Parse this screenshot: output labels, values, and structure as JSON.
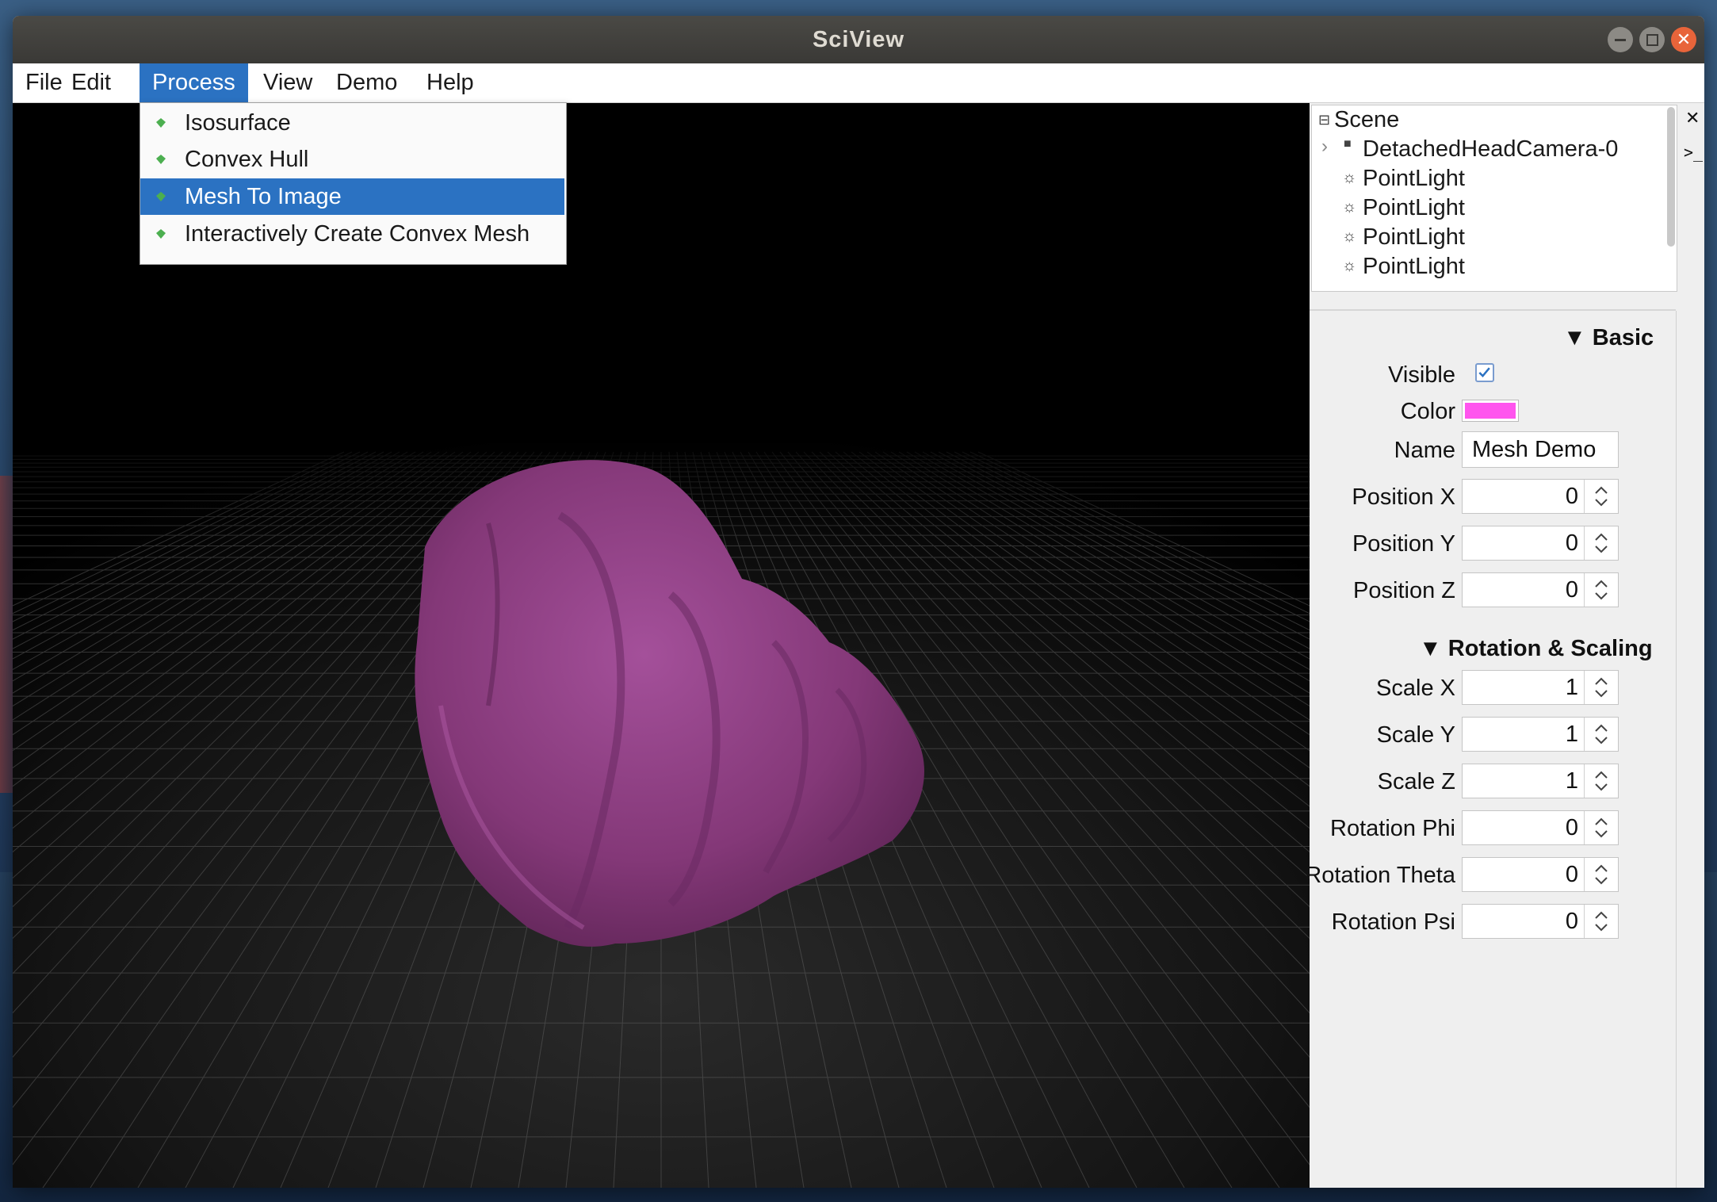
{
  "window": {
    "title": "SciView"
  },
  "menubar": {
    "items": [
      {
        "label": "File"
      },
      {
        "label": "Edit"
      },
      {
        "label": "Process"
      },
      {
        "label": "View"
      },
      {
        "label": "Demo"
      },
      {
        "label": "Help"
      }
    ]
  },
  "process_menu": {
    "items": [
      {
        "label": "Isosurface"
      },
      {
        "label": "Convex Hull"
      },
      {
        "label": "Mesh To Image",
        "highlighted": true
      },
      {
        "label": "Interactively Create Convex Mesh"
      }
    ]
  },
  "scene_tree": {
    "root": "Scene",
    "items": [
      {
        "label": "DetachedHeadCamera-0",
        "icon": "camera-icon"
      },
      {
        "label": "PointLight",
        "icon": "light-icon"
      },
      {
        "label": "PointLight",
        "icon": "light-icon"
      },
      {
        "label": "PointLight",
        "icon": "light-icon"
      },
      {
        "label": "PointLight",
        "icon": "light-icon"
      }
    ]
  },
  "properties": {
    "basic_title": "Basic",
    "visible_label": "Visible",
    "visible": true,
    "color_label": "Color",
    "color": "#ff55ee",
    "name_label": "Name",
    "name_value": "Mesh Demo",
    "position": [
      {
        "label": "Position X",
        "value": "0"
      },
      {
        "label": "Position Y",
        "value": "0"
      },
      {
        "label": "Position Z",
        "value": "0"
      }
    ],
    "rotation_title": "Rotation & Scaling",
    "transform": [
      {
        "label": "Scale X",
        "value": "1"
      },
      {
        "label": "Scale Y",
        "value": "1"
      },
      {
        "label": "Scale Z",
        "value": "1"
      },
      {
        "label": "Rotation Phi",
        "value": "0"
      },
      {
        "label": "Rotation Theta",
        "value": "0"
      },
      {
        "label": "Rotation Psi",
        "value": "0"
      }
    ]
  },
  "colors": {
    "accent": "#2b72c2",
    "mesh": "#8e3c82",
    "gem": "#4caf50"
  }
}
